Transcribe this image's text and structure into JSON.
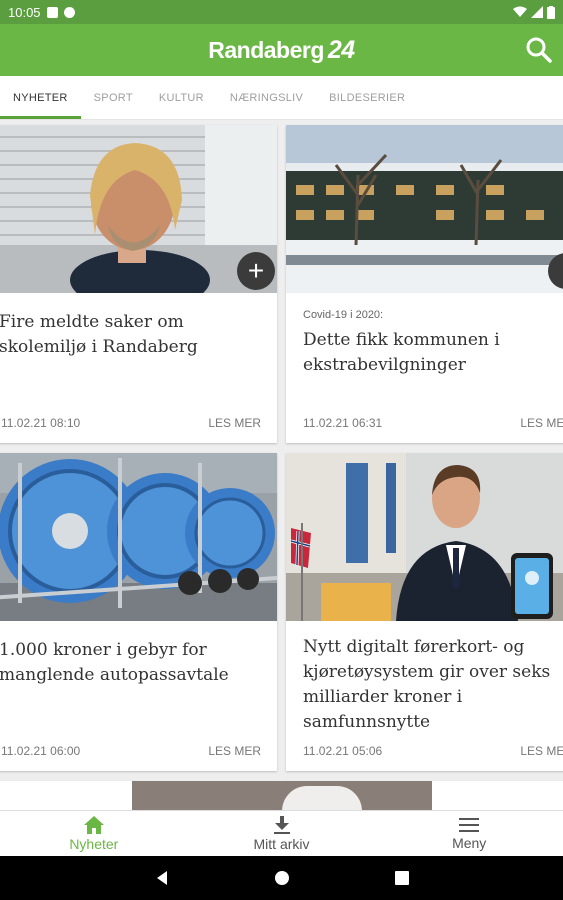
{
  "status_bar": {
    "time": "10:05"
  },
  "app": {
    "brand": "Randaberg",
    "brand_number": "24",
    "brand_color": "#6bb745"
  },
  "tabs": [
    {
      "label": "NYHETER",
      "active": true
    },
    {
      "label": "SPORT",
      "active": false
    },
    {
      "label": "KULTUR",
      "active": false
    },
    {
      "label": "NÆRINGSLIV",
      "active": false
    },
    {
      "label": "BILDESERIER",
      "active": false
    }
  ],
  "articles": [
    {
      "kicker": "",
      "title": "Fire meldte saker om skolemiljø i Randaberg",
      "date": "11.02.21 08:10",
      "more": "LES MER"
    },
    {
      "kicker": "Covid-19 i 2020:",
      "title": "Dette fikk kommunen i ekstrabevilgninger",
      "date": "11.02.21 06:31",
      "more": "LES MER"
    },
    {
      "kicker": "",
      "title": "1.000 kroner i gebyr for manglende autopassavtale",
      "date": "11.02.21 06:00",
      "more": "LES MER"
    },
    {
      "kicker": "",
      "title": "Nytt digitalt førerkort- og kjøretøysystem gir over seks milliarder kroner i samfunnsnytte",
      "date": "11.02.21 05:06",
      "more": "LES MER"
    }
  ],
  "bottom_nav": [
    {
      "label": "Nyheter",
      "icon": "home-icon",
      "active": true
    },
    {
      "label": "Mitt arkiv",
      "icon": "download-icon",
      "active": false
    },
    {
      "label": "Meny",
      "icon": "menu-icon",
      "active": false
    }
  ]
}
